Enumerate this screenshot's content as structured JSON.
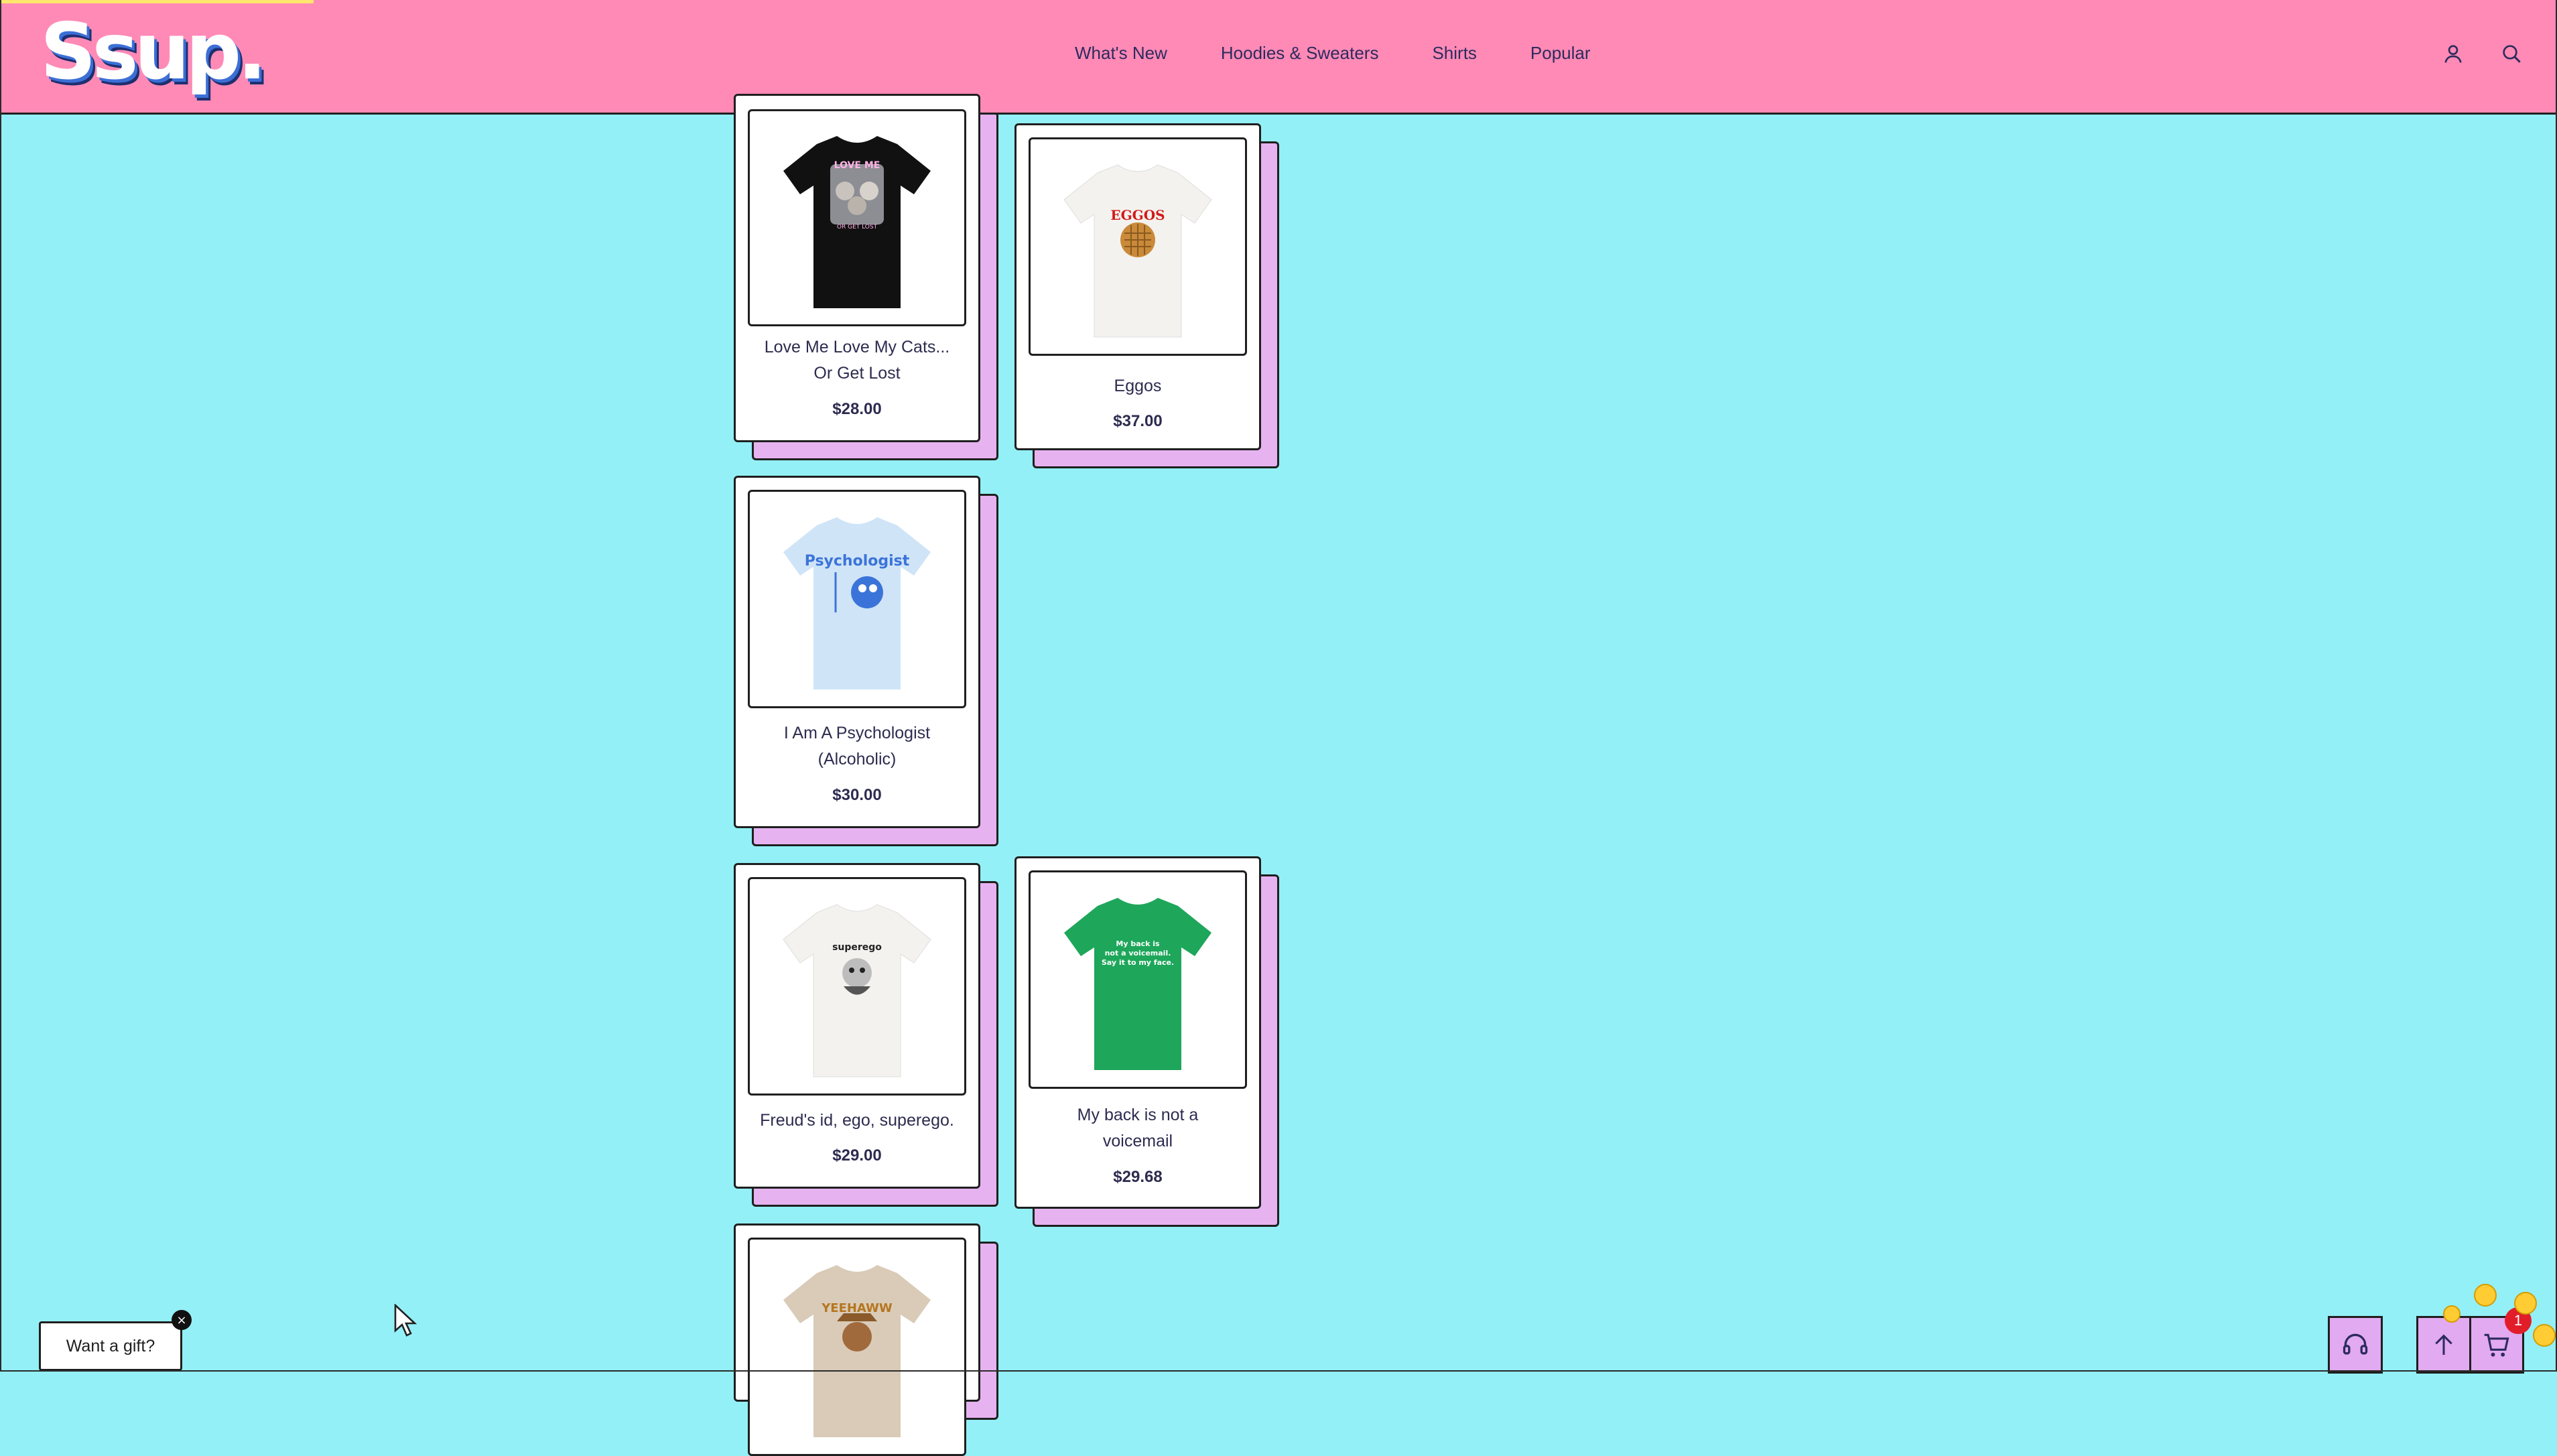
{
  "brand": {
    "logo_text": "Ssup."
  },
  "nav": {
    "items": [
      "What's New",
      "Hoodies & Sweaters",
      "Shirts",
      "Popular"
    ]
  },
  "header_icons": {
    "account": "user-icon",
    "search": "search-icon"
  },
  "products": [
    {
      "name_line1": "Love Me Love My Cats...",
      "name_line2": "Or Get Lost",
      "price": "$28.00",
      "shirt_color": "#111111",
      "print_text": "LOVE ME LOVE MY CATS"
    },
    {
      "name_line1": "Eggos",
      "name_line2": "",
      "price": "$37.00",
      "shirt_color": "#f4f2ee",
      "print_text": "EGGOS"
    },
    {
      "name_line1": "I Am A Psychologist",
      "name_line2": "(Alcoholic)",
      "price": "$30.00",
      "shirt_color": "#cfe4f7",
      "print_text": "Psychologist"
    },
    {
      "name_line1": "Freud's id, ego, superego.",
      "name_line2": "",
      "price": "$29.00",
      "shirt_color": "#f4f2ee",
      "print_text": "superego"
    },
    {
      "name_line1": "My back is not a",
      "name_line2": "voicemail",
      "price": "$29.68",
      "shirt_color": "#1ea65a",
      "print_text": "My back is not a voicemail"
    },
    {
      "name_line1": "",
      "name_line2": "",
      "price": "",
      "shirt_color": "#d9cbb8",
      "print_text": "YEEHAWW"
    }
  ],
  "gift_popup": {
    "label": "Want a gift?",
    "close": "×"
  },
  "floating": {
    "support_icon": "headset-icon",
    "top_icon": "arrow-up-icon",
    "cart_icon": "cart-icon",
    "cart_count": "1"
  }
}
